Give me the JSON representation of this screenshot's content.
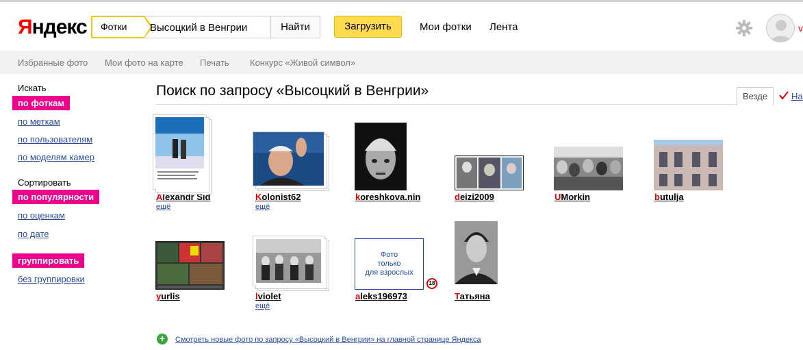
{
  "header": {
    "logo_first": "Я",
    "logo_rest": "ндекс",
    "service_tab": "Фотки",
    "search_value": "Высоцкий в Венгрии",
    "find_label": "Найти",
    "upload_label": "Загрузить",
    "my_photos": "Мои фотки",
    "feed": "Лента",
    "user_initial": "v"
  },
  "subnav": [
    "Избранные фото",
    "Мои фото на карте",
    "Печать",
    "Конкурс «Живой символ»"
  ],
  "sidebar": {
    "search_heading": "Искать",
    "search_active": "по фоткам",
    "search_links": [
      "по меткам",
      "по пользователям",
      "по моделям камер"
    ],
    "sort_heading": "Сортировать",
    "sort_active": "по популярности",
    "sort_links": [
      "по оценкам",
      "по дате"
    ],
    "group_active": "группировать",
    "group_link": "без группировки"
  },
  "main": {
    "title": "Поиск по запросу «Высоцкий в Венгрии»",
    "scope_tab": "Везде",
    "scope_other": "На",
    "more_label": "ещё",
    "adult_lines": [
      "Фото",
      "только",
      "для взрослых"
    ],
    "adult_badge": "18",
    "results": [
      {
        "first": "A",
        "rest": "lexandr Sid",
        "more": true
      },
      {
        "first": "K",
        "rest": "olonist62",
        "more": true
      },
      {
        "first": "k",
        "rest": "oreshkova.nin",
        "more": false
      },
      {
        "first": "d",
        "rest": "eizi2009",
        "more": false
      },
      {
        "first": "U",
        "rest": "Morkin",
        "more": false
      },
      {
        "first": "b",
        "rest": "utulja",
        "more": false
      },
      {
        "first": "y",
        "rest": "urlis",
        "more": false
      },
      {
        "first": "l",
        "rest": "violet",
        "more": true
      },
      {
        "first": "a",
        "rest": "leks196973",
        "more": false
      },
      {
        "first": "Т",
        "rest": "атьяна",
        "more": false
      }
    ],
    "footer_link": "Смотреть новые фото по запросу «Высоцкий в Венгрии» на главной странице Яндекса"
  },
  "colors": {
    "accent_yellow": "#ffdb4d",
    "pink": "#ec008c",
    "link": "#2a4b9b",
    "red": "#dd0000"
  }
}
